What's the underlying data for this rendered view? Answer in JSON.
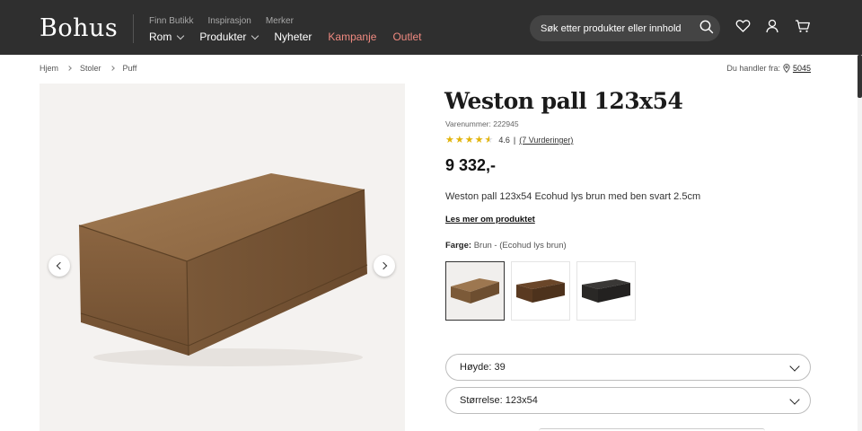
{
  "header": {
    "logo": "Bohus",
    "subnav": [
      "Finn Butikk",
      "Inspirasjon",
      "Merker"
    ],
    "mainnav": [
      {
        "label": "Rom",
        "dropdown": true
      },
      {
        "label": "Produkter",
        "dropdown": true
      },
      {
        "label": "Nyheter",
        "dropdown": false
      },
      {
        "label": "Kampanje",
        "dropdown": false
      },
      {
        "label": "Outlet",
        "dropdown": false
      }
    ],
    "search_placeholder": "Søk etter produkter eller innhold ...",
    "icons": [
      "search-icon",
      "heart-icon",
      "user-icon",
      "cart-icon"
    ],
    "promo_color": "#f08a80"
  },
  "breadcrumb": [
    "Hjem",
    "Stoler",
    "Puff"
  ],
  "location": {
    "label": "Du handler fra:",
    "zip": "5045"
  },
  "product": {
    "title": "Weston pall 123x54",
    "sku": "Varenummer: 222945",
    "rating": 4.6,
    "rating_text": "4.6",
    "reviews": "(7 Vurderinger)",
    "price": "9 332,-",
    "description": "Weston pall 123x54 Ecohud lys brun med ben svart 2.5cm",
    "read_more": "Les mer om produktet",
    "color_label": "Farge:",
    "color_value": "Brun - (Ecohud lys brun)",
    "swatches": [
      {
        "name": "lys brun",
        "color": "#8a6440",
        "selected": true
      },
      {
        "name": "brun",
        "color": "#5e3c22",
        "selected": false
      },
      {
        "name": "svart",
        "color": "#2c2a28",
        "selected": false
      }
    ],
    "height_select": "Høyde: 39",
    "size_select": "Størrelse: 123x54"
  }
}
